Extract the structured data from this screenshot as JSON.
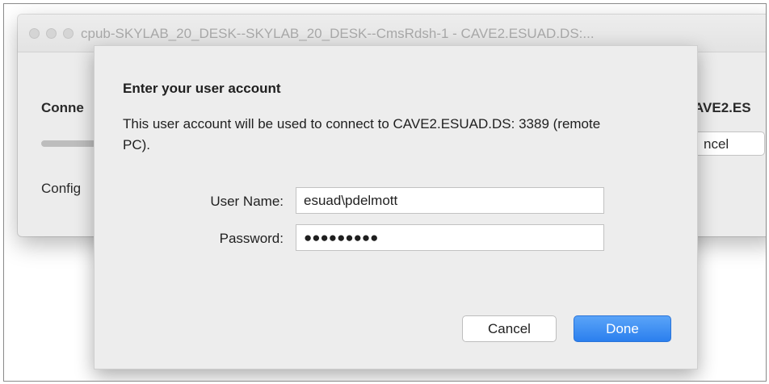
{
  "window": {
    "title": "cpub-SKYLAB_20_DESK--SKYLAB_20_DESK--CmsRdsh-1 - CAVE2.ESUAD.DS:...",
    "connecting_label": "Conne",
    "config_label": "Config",
    "host_label": "AVE2.ES",
    "cancel_label": "ncel"
  },
  "dialog": {
    "title": "Enter your user account",
    "message": "This user account will be used to connect to CAVE2.ESUAD.DS: 3389 (remote PC).",
    "username_label": "User Name:",
    "username_value": "esuad\\pdelmott",
    "password_label": "Password:",
    "password_value": "●●●●●●●●●",
    "cancel_label": "Cancel",
    "done_label": "Done"
  },
  "colors": {
    "accent": "#2b7fee",
    "sheet_bg": "#ededed"
  }
}
